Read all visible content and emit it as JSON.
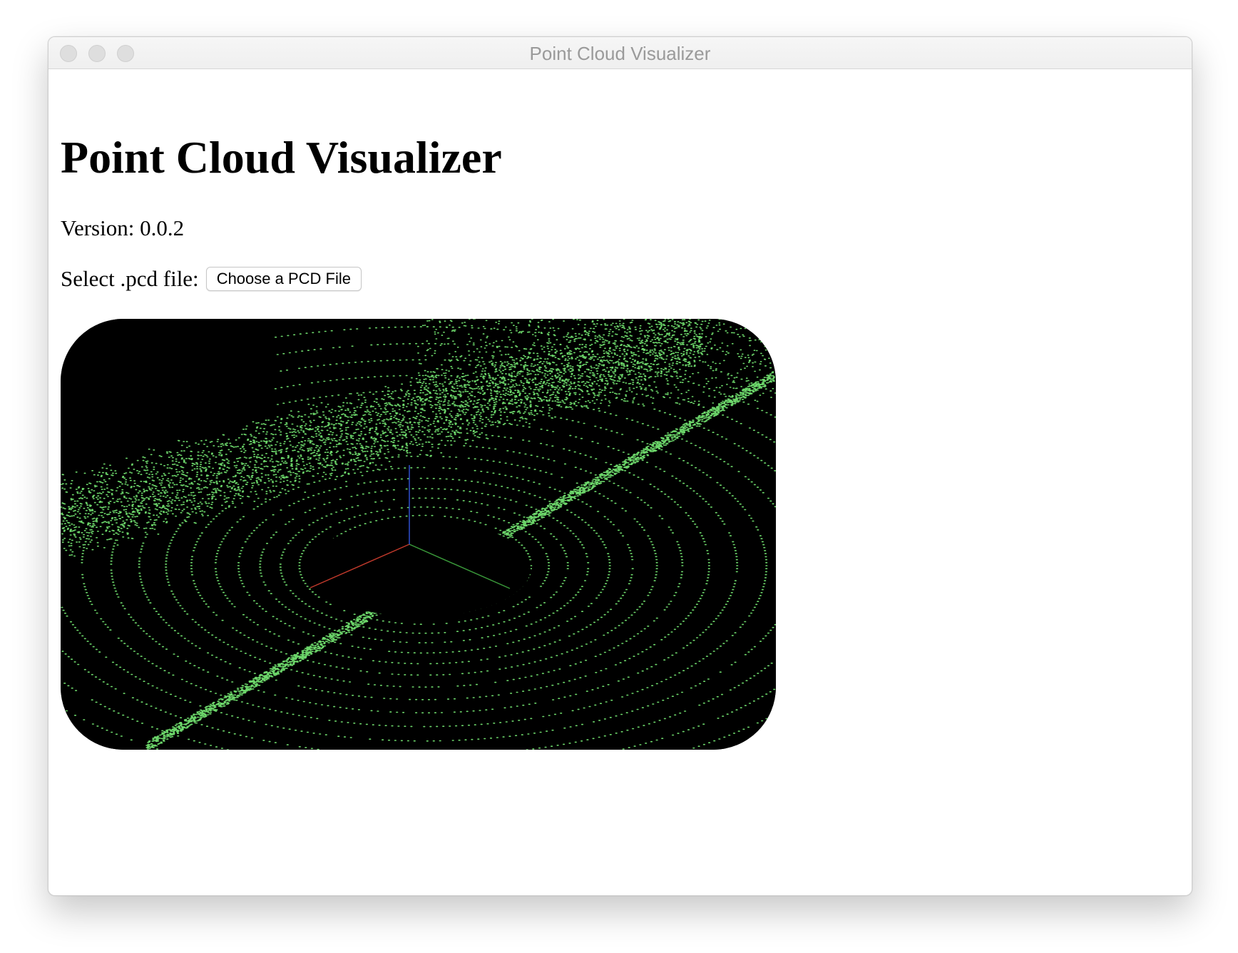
{
  "window": {
    "title": "Point Cloud Visualizer"
  },
  "page": {
    "heading": "Point Cloud Visualizer",
    "version_text": "Version: 0.0.2",
    "file_label": "Select .pcd file:",
    "file_button_label": "Choose a PCD File"
  },
  "viewer": {
    "background_color": "#000000",
    "point_color": "#6cd66a",
    "axes": [
      {
        "name": "x-axis",
        "color": "#c0392b"
      },
      {
        "name": "y-axis",
        "color": "#3a9a3a"
      },
      {
        "name": "z-axis",
        "color": "#2f4fd0"
      }
    ]
  }
}
